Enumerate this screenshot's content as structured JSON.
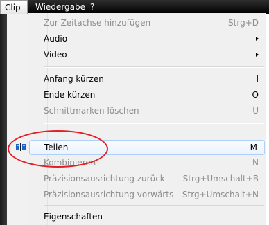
{
  "menubar": {
    "items": [
      {
        "label": "Clip",
        "active": true
      },
      {
        "label": "Wiedergabe",
        "active": false
      },
      {
        "label": "?",
        "active": false
      }
    ]
  },
  "menu": {
    "items": [
      {
        "label": "Zur Zeitachse hinzufügen",
        "shortcut": "Strg+D",
        "disabled": true
      },
      {
        "label": "Audio",
        "submenu": true
      },
      {
        "label": "Video",
        "submenu": true
      },
      {
        "label": "Anfang kürzen",
        "shortcut": "I"
      },
      {
        "label": "Ende kürzen",
        "shortcut": "O"
      },
      {
        "label": "Schnittmarken löschen",
        "shortcut": "U",
        "disabled": true
      },
      {
        "label": "Teilen",
        "shortcut": "M",
        "highlighted": true,
        "icon": "split-clip-icon"
      },
      {
        "label": "Kombinieren",
        "shortcut": "N",
        "disabled": true
      },
      {
        "label": "Präzisionsausrichtung zurück",
        "shortcut": "Strg+Umschalt+B",
        "disabled": true
      },
      {
        "label": "Präzisionsausrichtung vorwärts",
        "shortcut": "Strg+Umschalt+N",
        "disabled": true
      },
      {
        "label": "Eigenschaften"
      }
    ]
  },
  "colors": {
    "highlight_border": "#aecff7",
    "annotation_circle": "#e21f26",
    "disabled_text": "#8d8d8d"
  }
}
